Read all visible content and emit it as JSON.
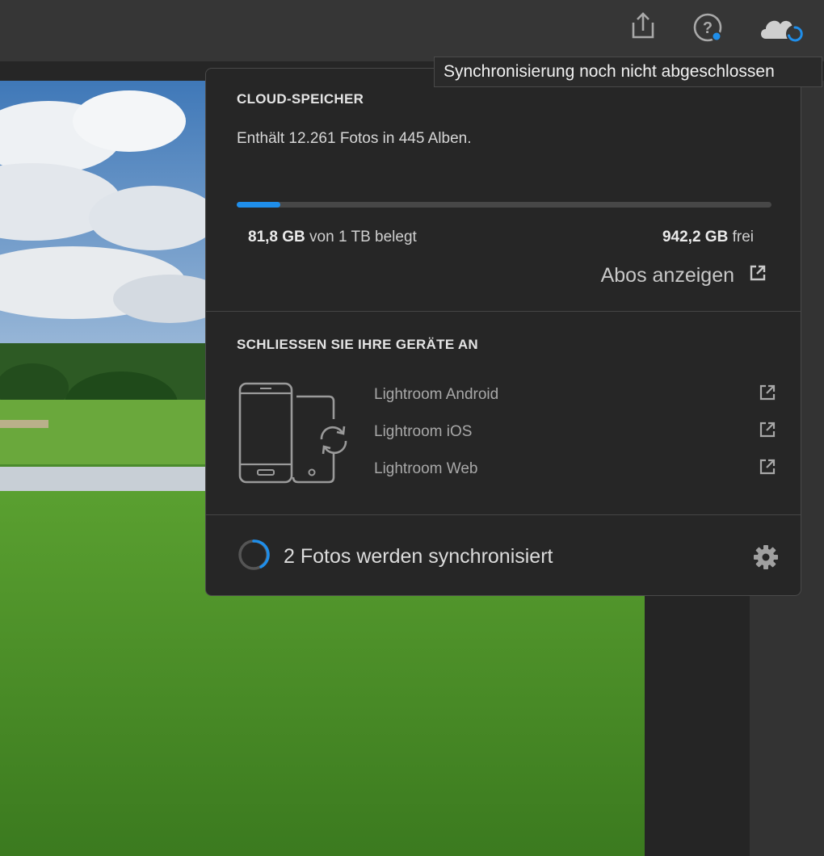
{
  "topbar": {
    "icons": [
      "share-icon",
      "help-icon",
      "cloud-sync-icon"
    ],
    "help_dot_color": "#1f8eea",
    "sync_color": "#1f8eea"
  },
  "tooltip": {
    "text": "Synchronisierung noch nicht abgeschlossen"
  },
  "cloud_storage": {
    "title": "CLOUD-SPEICHER",
    "info": "Enthält 12.261 Fotos in 445 Alben.",
    "used_value": "81,8 GB",
    "used_label": "von 1 TB belegt",
    "free_value": "942,2 GB",
    "free_label": "frei",
    "usage_fraction": 0.0818,
    "accent_color": "#1f8eea",
    "plans_link": "Abos anzeigen"
  },
  "devices": {
    "title": "SCHLIESSEN SIE IHRE GERÄTE AN",
    "apps": [
      {
        "label": "Lightroom Android"
      },
      {
        "label": "Lightroom iOS"
      },
      {
        "label": "Lightroom Web"
      }
    ]
  },
  "sync": {
    "status": "2 Fotos werden synchronisiert"
  }
}
